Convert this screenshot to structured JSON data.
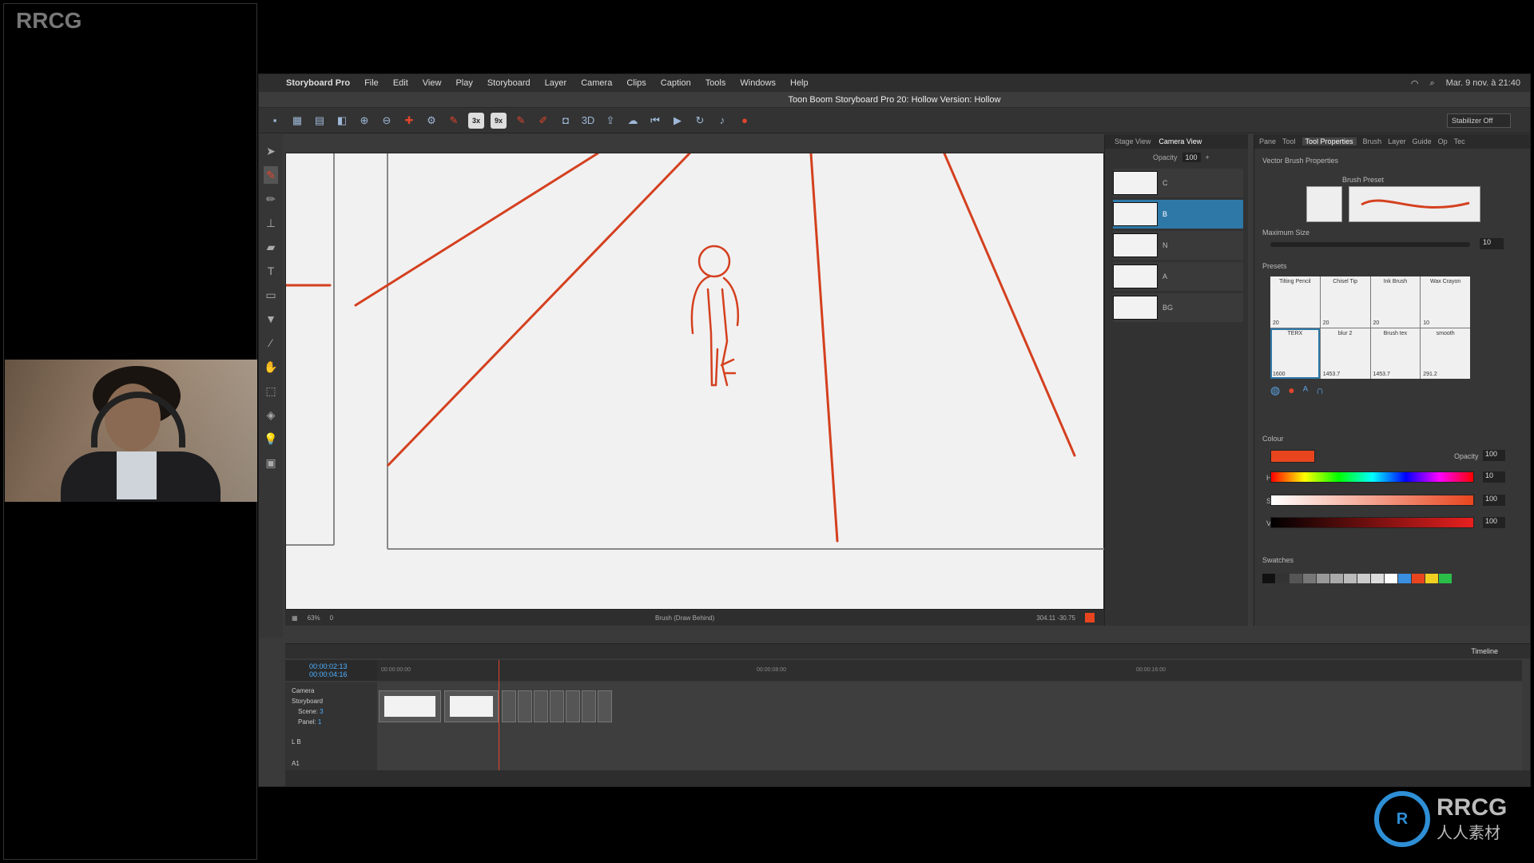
{
  "overlay": {
    "brand": "RRCG",
    "logo_title": "RRCG",
    "logo_subtitle": "人人素材"
  },
  "menubar": {
    "items": [
      "Storyboard Pro",
      "File",
      "Edit",
      "View",
      "Play",
      "Storyboard",
      "Layer",
      "Camera",
      "Clips",
      "Caption",
      "Tools",
      "Windows",
      "Help"
    ],
    "datetime": "Mar. 9 nov. à 21:40"
  },
  "window": {
    "title": "Toon Boom Storyboard Pro 20: Hollow Version: Hollow"
  },
  "toolbar": {
    "zoom_a": "3x",
    "zoom_b": "9x",
    "stabilizer": "Stabilizer Off",
    "view3d": "3D"
  },
  "layers_panel": {
    "tabs": [
      "Stage View",
      "Camera View"
    ],
    "opacity_label": "Opacity",
    "opacity_value": "100",
    "layers": [
      {
        "name": "C"
      },
      {
        "name": "B"
      },
      {
        "name": "N"
      },
      {
        "name": "A"
      },
      {
        "name": "BG"
      }
    ]
  },
  "stage_status": {
    "zoom": "63%",
    "frame": "0",
    "mode": "Brush (Draw Behind)",
    "coords": "304.11 -30.75"
  },
  "properties": {
    "tabs": [
      "Pane",
      "Tool",
      "Tool Properties",
      "Brush",
      "Layer",
      "Guide",
      "Op",
      "Tec"
    ],
    "title": "Vector Brush Properties",
    "brush_preset_label": "Brush Preset",
    "max_size_label": "Maximum Size",
    "max_size_value": "10",
    "presets_label": "Presets",
    "presets": [
      {
        "name": "Tilting Pencil",
        "size": "20"
      },
      {
        "name": "Chisel Tip",
        "size": "20"
      },
      {
        "name": "Ink Brush",
        "size": "20"
      },
      {
        "name": "Wax Crayon",
        "size": "10"
      },
      {
        "name": "TERX",
        "size": "1600"
      },
      {
        "name": "blur 2",
        "size": "1453.7"
      },
      {
        "name": "Brush tex",
        "size": "1453.7"
      },
      {
        "name": "smooth",
        "size": "291.2"
      }
    ],
    "colour_label": "Colour",
    "colour_opacity_label": "Opacity",
    "colour_opacity": "100",
    "h_label": "H",
    "h_value": "10",
    "s_label": "S",
    "s_value": "100",
    "v_label": "V",
    "v_value": "100",
    "swatches_label": "Swatches",
    "current_color": "#e8451f"
  },
  "timeline": {
    "title": "Timeline",
    "time_current": "00:00:02:13",
    "time_total": "00:00:04:16",
    "ruler": [
      "00:00:00:00",
      "00:00:08:00",
      "00:00:16:00"
    ],
    "camera_label": "Camera",
    "storyboard_label": "Storyboard",
    "scene_label": "Scene:",
    "scene_value": "3",
    "panel_label": "Panel:",
    "panel_value": "1",
    "track_lb": "L B",
    "track_a1": "A1"
  }
}
